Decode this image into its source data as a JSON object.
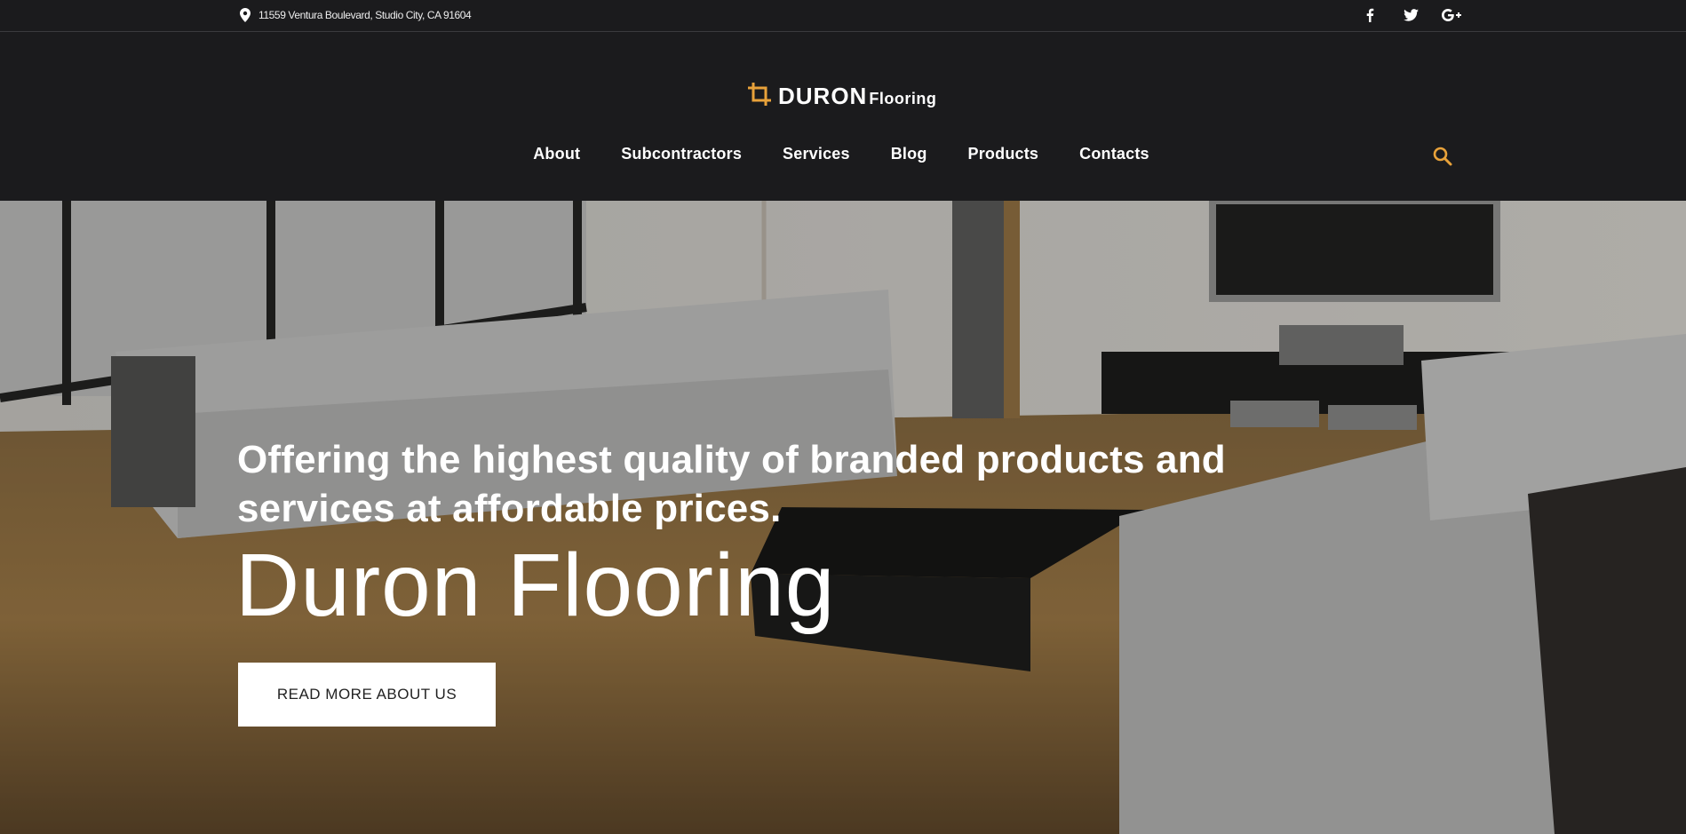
{
  "topbar": {
    "address": "11559 Ventura Boulevard, Studio City, CA 91604",
    "address_icon": "map-pin-icon",
    "social": [
      {
        "name": "facebook-icon",
        "glyph": "f"
      },
      {
        "name": "twitter-icon",
        "glyph": "t"
      },
      {
        "name": "google-plus-icon",
        "glyph": "G+"
      }
    ]
  },
  "header": {
    "logo_main": "DURON",
    "logo_sub": "Flooring",
    "logo_icon": "crop-icon",
    "nav": [
      "About",
      "Subcontractors",
      "Services",
      "Blog",
      "Products",
      "Contacts"
    ],
    "search_icon": "search-icon"
  },
  "hero": {
    "subtitle": "Offering the highest quality of branded products and services at affordable prices.",
    "title": "Duron Flooring",
    "cta_label": "READ MORE ABOUT US"
  },
  "colors": {
    "accent": "#e8a23a",
    "dark": "#1b1b1d",
    "white": "#ffffff"
  }
}
